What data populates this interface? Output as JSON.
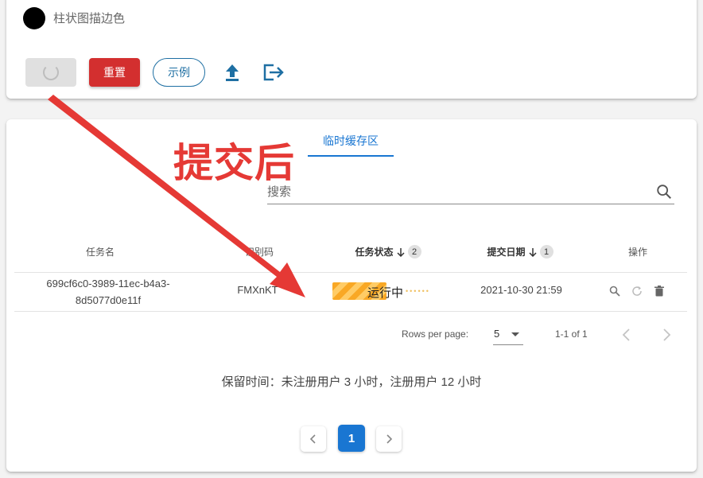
{
  "top_panel": {
    "color_label": "柱状图描边色",
    "buttons": {
      "reset": "重置",
      "example": "示例"
    },
    "icons": {
      "upload": "upload-icon",
      "export": "export-icon",
      "loading": "spinner-icon"
    }
  },
  "tabs": [
    {
      "label": "临时缓存区"
    }
  ],
  "search": {
    "placeholder": "搜索",
    "value": ""
  },
  "table": {
    "headers": {
      "task_name": "任务名",
      "code": "识别码",
      "status": "任务状态",
      "status_sort": "2",
      "date": "提交日期",
      "date_sort": "1",
      "actions": "操作"
    },
    "rows": [
      {
        "task_name_line1": "699cf6c0-3989-11ec-b4a3-",
        "task_name_line2": "8d5077d0e11f",
        "code": "FMXnKT",
        "status": "运行中",
        "date": "2021-10-30 21:59"
      }
    ]
  },
  "pagination": {
    "rows_per_page_label": "Rows per page:",
    "rows_per_page": "5",
    "range": "1-1 of 1",
    "current_page": "1"
  },
  "retention_note": "保留时间：未注册用户 3 小时，注册用户 12 小时",
  "annotation": {
    "text": "提交后",
    "color": "#e53935"
  },
  "colors": {
    "primary": "#1976d2",
    "danger": "#d32f2f",
    "outline": "#1e6fa3",
    "status_bar": "#f9a825"
  }
}
